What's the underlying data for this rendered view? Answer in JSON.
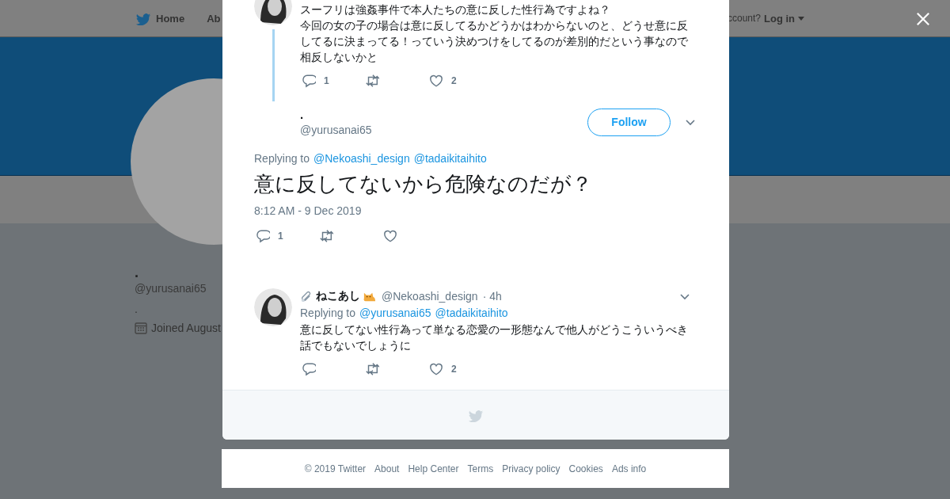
{
  "nav": {
    "items": [
      {
        "kind": "home",
        "label": "Home"
      },
      {
        "kind": "text",
        "label": "Ab"
      }
    ],
    "account_prompt": "ccount?",
    "login": "Log in"
  },
  "profile": {
    "name": ".",
    "handle": "@yurusanai65",
    "bio": ".",
    "joined": "Joined August"
  },
  "modal": {
    "parent_tweet": {
      "paragraphs": [
        "スーフリは強姦事件で本人たちの意に反した性行為ですよね？",
        "今回の女の子の場合は意に反してるかどうかはわからないのと、どうせ意に反してるに決まってる！っていう決めつけをしてるのが差別的だという事なので相反しないかと"
      ],
      "actions": [
        {
          "kind": "reply",
          "count": "1"
        },
        {
          "kind": "retweet"
        },
        {
          "kind": "like",
          "count": "2"
        }
      ]
    },
    "main_tweet": {
      "name": ".",
      "handle": "@yurusanai65",
      "follow": "Follow",
      "replying_label": "Replying to",
      "replying_to": [
        "@Nekoashi_design",
        "@tadaikitaihito"
      ],
      "text": "意に反してないから危険なのだが？",
      "time": "8:12 AM - 9 Dec 2019",
      "actions": [
        {
          "kind": "reply",
          "count": "1"
        },
        {
          "kind": "retweet"
        },
        {
          "kind": "like"
        }
      ]
    },
    "reply_tweet": {
      "name": "ねこあし",
      "handle": "@Nekoashi_design",
      "age": "· 4h",
      "replying_label": "Replying to",
      "replying_to": [
        "@yurusanai65",
        "@tadaikitaihito"
      ],
      "text": "意に反してない性行為って単なる恋愛の一形態なんで他人がどうこういうべき話でもないでしょうに",
      "actions": [
        {
          "kind": "reply"
        },
        {
          "kind": "retweet"
        },
        {
          "kind": "like",
          "count": "2"
        }
      ]
    }
  },
  "footer": [
    "© 2019 Twitter",
    "About",
    "Help Center",
    "Terms",
    "Privacy policy",
    "Cookies",
    "Ads info"
  ]
}
